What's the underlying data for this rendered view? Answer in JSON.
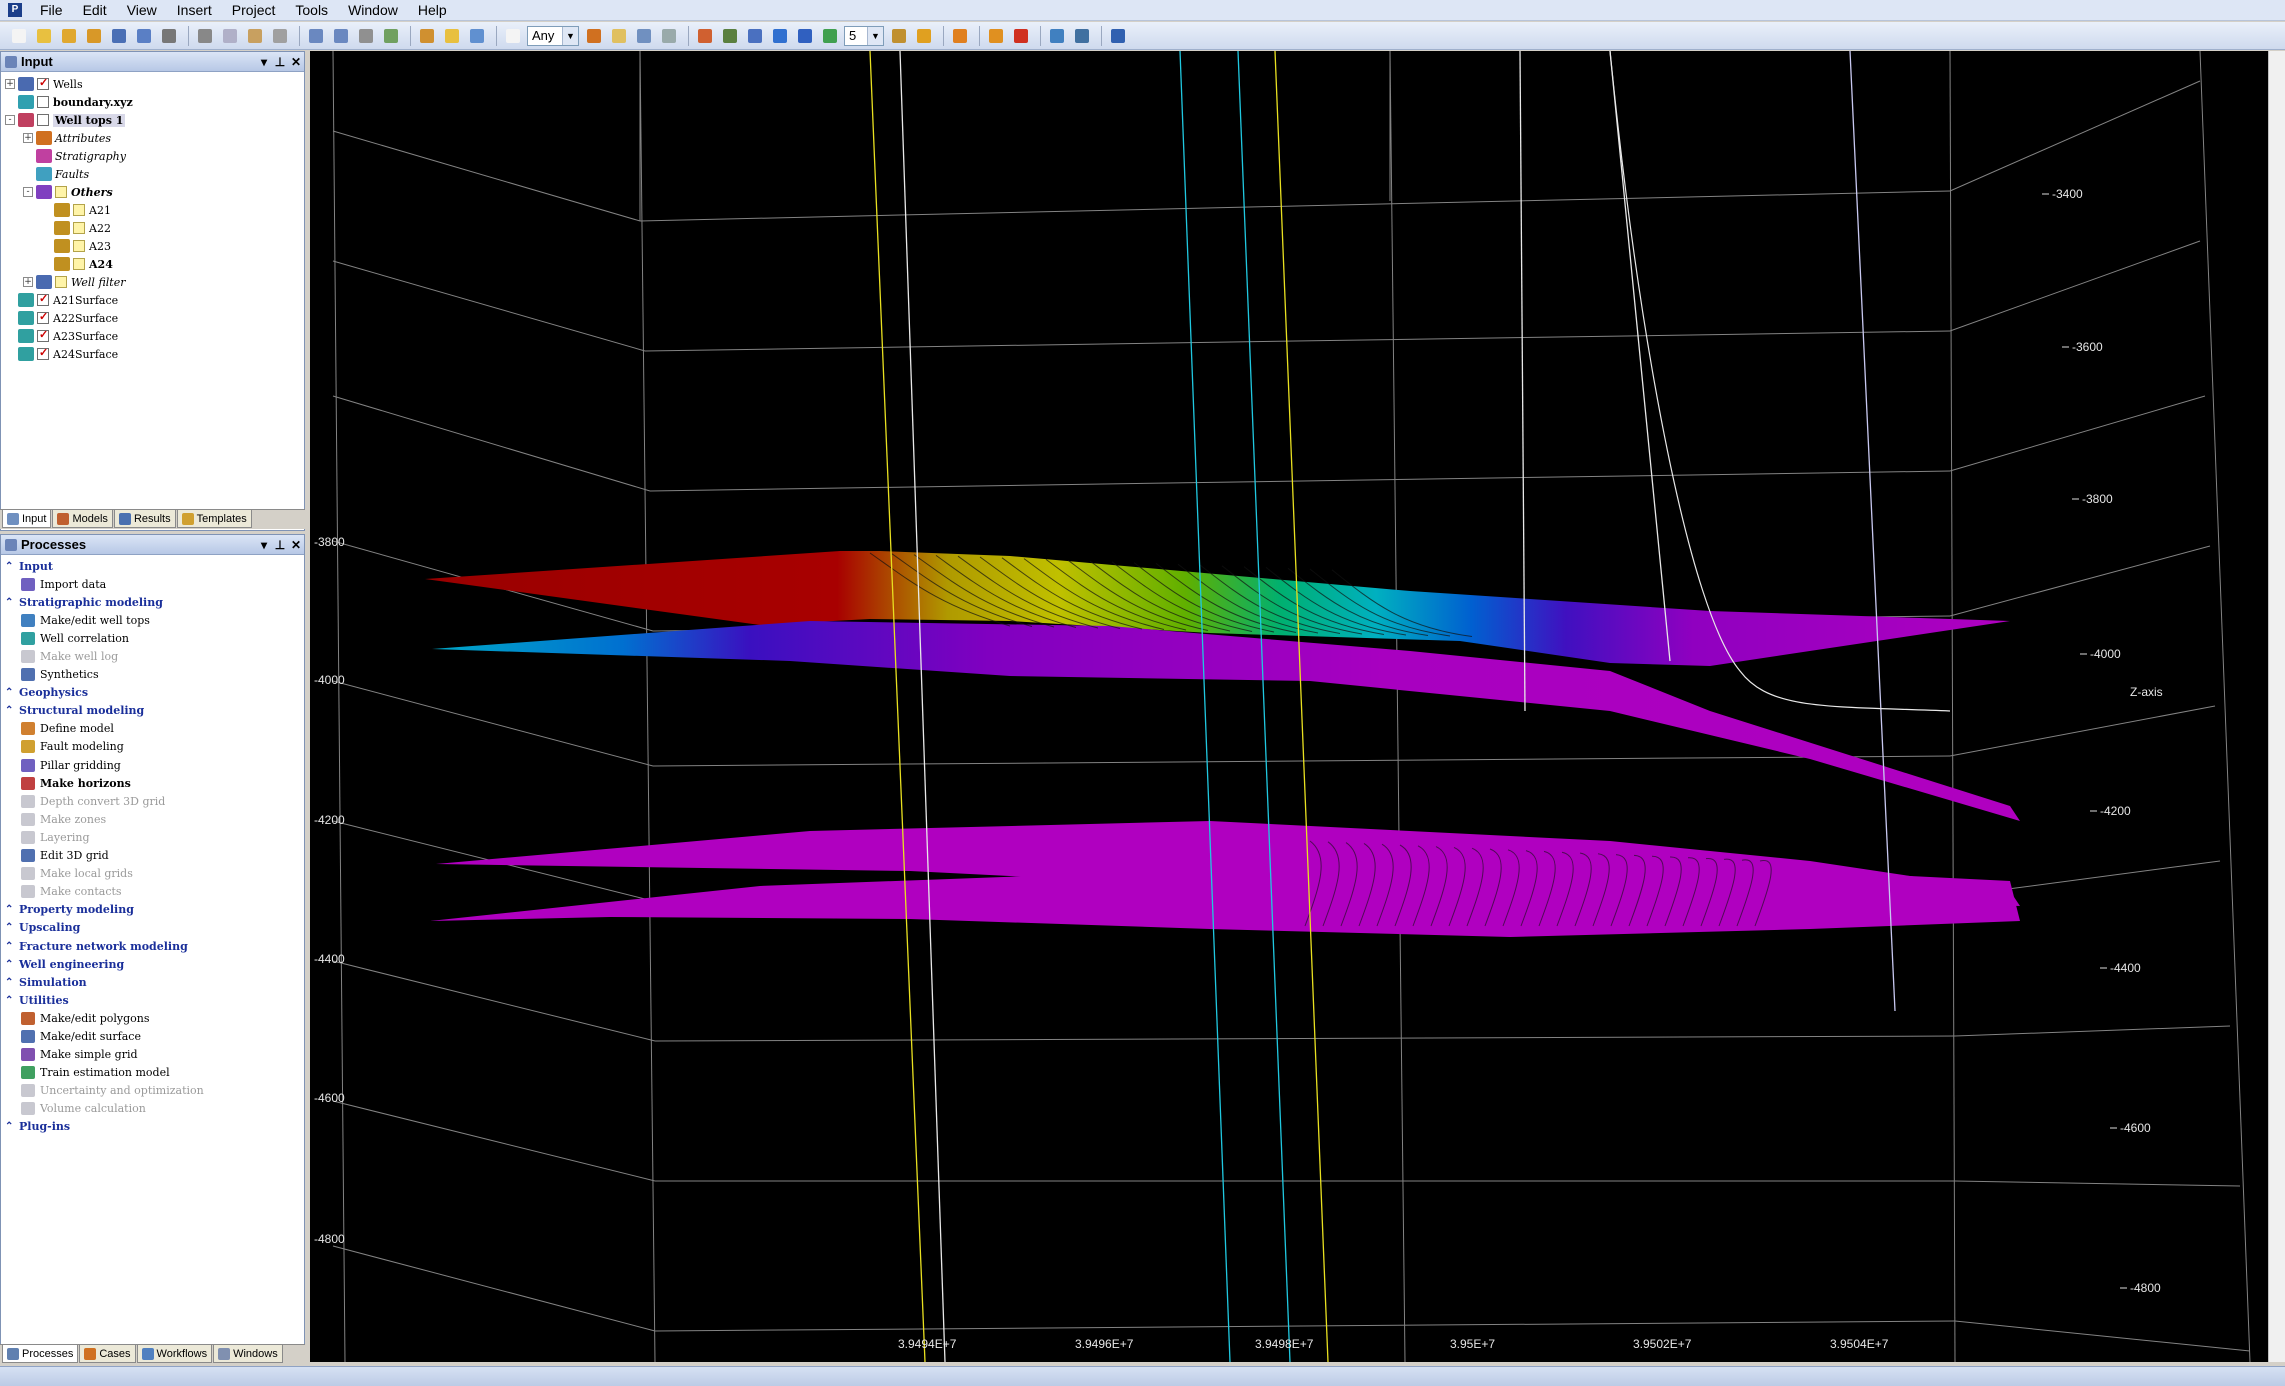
{
  "menu": {
    "items": [
      {
        "name": "menu-file",
        "label": "File"
      },
      {
        "name": "menu-edit",
        "label": "Edit"
      },
      {
        "name": "menu-view",
        "label": "View"
      },
      {
        "name": "menu-insert",
        "label": "Insert"
      },
      {
        "name": "menu-project",
        "label": "Project"
      },
      {
        "name": "menu-tools",
        "label": "Tools"
      },
      {
        "name": "menu-window",
        "label": "Window"
      },
      {
        "name": "menu-help",
        "label": "Help"
      }
    ]
  },
  "toolbar": {
    "filter_value": "Any",
    "number_value": "5"
  },
  "input_panel": {
    "title": "Input",
    "items": [
      {
        "label": "Wells",
        "indent": 0,
        "expander": "+",
        "checkbox": "checked",
        "icon": "wells-icon",
        "style": ""
      },
      {
        "label": "boundary.xyz",
        "indent": 0,
        "expander": "",
        "checkbox": "unchecked",
        "icon": "polygon-icon",
        "style": "bold"
      },
      {
        "label": "Well tops 1",
        "indent": 0,
        "expander": "-",
        "checkbox": "unchecked",
        "icon": "well-tops-icon",
        "style": "sel"
      },
      {
        "label": "Attributes",
        "indent": 1,
        "expander": "+",
        "checkbox": "none",
        "icon": "attributes-icon",
        "style": "italic"
      },
      {
        "label": "Stratigraphy",
        "indent": 1,
        "expander": "",
        "checkbox": "none",
        "icon": "stratigraphy-icon",
        "style": "italic"
      },
      {
        "label": "Faults",
        "indent": 1,
        "expander": "",
        "checkbox": "none",
        "icon": "faults-icon",
        "style": "italic"
      },
      {
        "label": "Others",
        "indent": 1,
        "expander": "-",
        "checkbox": "yellow",
        "icon": "others-icon",
        "style": "italic bold"
      },
      {
        "label": "A21",
        "indent": 2,
        "expander": "",
        "checkbox": "yellow",
        "icon": "horizon-marker-icon",
        "style": ""
      },
      {
        "label": "A22",
        "indent": 2,
        "expander": "",
        "checkbox": "yellow",
        "icon": "horizon-marker-icon",
        "style": ""
      },
      {
        "label": "A23",
        "indent": 2,
        "expander": "",
        "checkbox": "yellow",
        "icon": "horizon-marker-icon",
        "style": ""
      },
      {
        "label": "A24",
        "indent": 2,
        "expander": "",
        "checkbox": "yellow",
        "icon": "horizon-marker-icon",
        "style": "bold"
      },
      {
        "label": "Well filter",
        "indent": 1,
        "expander": "+",
        "checkbox": "yellow",
        "icon": "well-filter-icon",
        "style": "italic"
      },
      {
        "label": "A21Surface",
        "indent": 0,
        "expander": "",
        "checkbox": "checked",
        "icon": "surface-icon",
        "style": ""
      },
      {
        "label": "A22Surface",
        "indent": 0,
        "expander": "",
        "checkbox": "checked",
        "icon": "surface-icon",
        "style": ""
      },
      {
        "label": "A23Surface",
        "indent": 0,
        "expander": "",
        "checkbox": "checked",
        "icon": "surface-icon",
        "style": ""
      },
      {
        "label": "A24Surface",
        "indent": 0,
        "expander": "",
        "checkbox": "checked",
        "icon": "surface-icon",
        "style": ""
      }
    ],
    "tabs": [
      "Input",
      "Models",
      "Results",
      "Templates"
    ]
  },
  "processes_panel": {
    "title": "Processes",
    "rows": [
      {
        "type": "cat",
        "label": "Input"
      },
      {
        "type": "item",
        "label": "Import data",
        "state": ""
      },
      {
        "type": "cat",
        "label": "Stratigraphic modeling"
      },
      {
        "type": "item",
        "label": "Make/edit well tops",
        "state": ""
      },
      {
        "type": "item",
        "label": "Well correlation",
        "state": ""
      },
      {
        "type": "item",
        "label": "Make well log",
        "state": "disabled"
      },
      {
        "type": "item",
        "label": "Synthetics",
        "state": ""
      },
      {
        "type": "cat",
        "label": "Geophysics"
      },
      {
        "type": "cat",
        "label": "Structural modeling"
      },
      {
        "type": "item",
        "label": "Define model",
        "state": ""
      },
      {
        "type": "item",
        "label": "Fault modeling",
        "state": ""
      },
      {
        "type": "item",
        "label": "Pillar gridding",
        "state": ""
      },
      {
        "type": "item",
        "label": "Make horizons",
        "state": "bold"
      },
      {
        "type": "item",
        "label": "Depth convert 3D grid",
        "state": "disabled"
      },
      {
        "type": "item",
        "label": "Make zones",
        "state": "disabled"
      },
      {
        "type": "item",
        "label": "Layering",
        "state": "disabled"
      },
      {
        "type": "item",
        "label": "Edit 3D grid",
        "state": ""
      },
      {
        "type": "item",
        "label": "Make local grids",
        "state": "disabled"
      },
      {
        "type": "item",
        "label": "Make contacts",
        "state": "disabled"
      },
      {
        "type": "cat",
        "label": "Property modeling"
      },
      {
        "type": "cat",
        "label": "Upscaling"
      },
      {
        "type": "cat",
        "label": "Fracture network modeling"
      },
      {
        "type": "cat",
        "label": "Well engineering"
      },
      {
        "type": "cat",
        "label": "Simulation"
      },
      {
        "type": "cat",
        "label": "Utilities"
      },
      {
        "type": "item",
        "label": "Make/edit polygons",
        "state": ""
      },
      {
        "type": "item",
        "label": "Make/edit surface",
        "state": ""
      },
      {
        "type": "item",
        "label": "Make simple grid",
        "state": ""
      },
      {
        "type": "item",
        "label": "Train estimation model",
        "state": ""
      },
      {
        "type": "item",
        "label": "Uncertainty and optimization",
        "state": "disabled"
      },
      {
        "type": "item",
        "label": "Volume calculation",
        "state": "disabled"
      },
      {
        "type": "cat",
        "label": "Plug-ins"
      }
    ],
    "tabs": [
      "Processes",
      "Cases",
      "Workflows",
      "Windows"
    ]
  },
  "viewport": {
    "left_axis_labels": [
      "-3800",
      "-4000",
      "-4200",
      "-4400",
      "-4600",
      "-4800"
    ],
    "right_axis_labels": [
      "-3400",
      "-3600",
      "-3800",
      "-4000",
      "-4200",
      "-4400",
      "-4600",
      "-4800"
    ],
    "z_axis_title": "Z-axis",
    "bottom_axis_labels": [
      "3.9494E+7",
      "3.9496E+7",
      "3.9498E+7",
      "3.95E+7",
      "3.9502E+7",
      "3.9504E+7"
    ],
    "colors": {
      "surface_purple": "#b000c0",
      "surface_red": "#a00000",
      "well_yellow": "#e8e020",
      "well_cyan": "#20c8e0",
      "well_white": "#e8e8e8"
    }
  }
}
